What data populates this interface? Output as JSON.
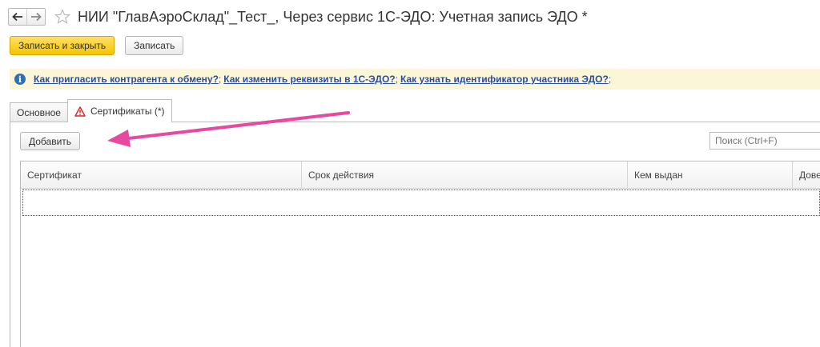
{
  "window": {
    "title": "НИИ \"ГлавАэроСклад\"_Тест_, Через сервис 1С-ЭДО: Учетная запись ЭДО *"
  },
  "toolbar": {
    "save_close_label": "Записать и закрыть",
    "save_label": "Записать"
  },
  "infobar": {
    "links": [
      "Как пригласить контрагента к обмену?",
      "Как изменить реквизиты в 1С-ЭДО?",
      "Как узнать идентификатор участника ЭДО?"
    ],
    "separator": ";"
  },
  "tabs": [
    {
      "label": "Основное"
    },
    {
      "label": "Сертификаты (*)"
    }
  ],
  "panel": {
    "add_label": "Добавить",
    "search_placeholder": "Поиск (Ctrl+F)"
  },
  "table": {
    "columns": [
      "Сертификат",
      "Срок действия",
      "Кем выдан",
      "Дове"
    ]
  },
  "colors": {
    "primary_button": "#f5c400",
    "info_bar": "#fbf6d7",
    "link": "#2a4ea0",
    "annotation_arrow": "#e8489f",
    "warning": "#e02020"
  },
  "icons": [
    "back-arrow-icon",
    "forward-arrow-icon",
    "star-icon",
    "info-icon",
    "warning-icon"
  ]
}
